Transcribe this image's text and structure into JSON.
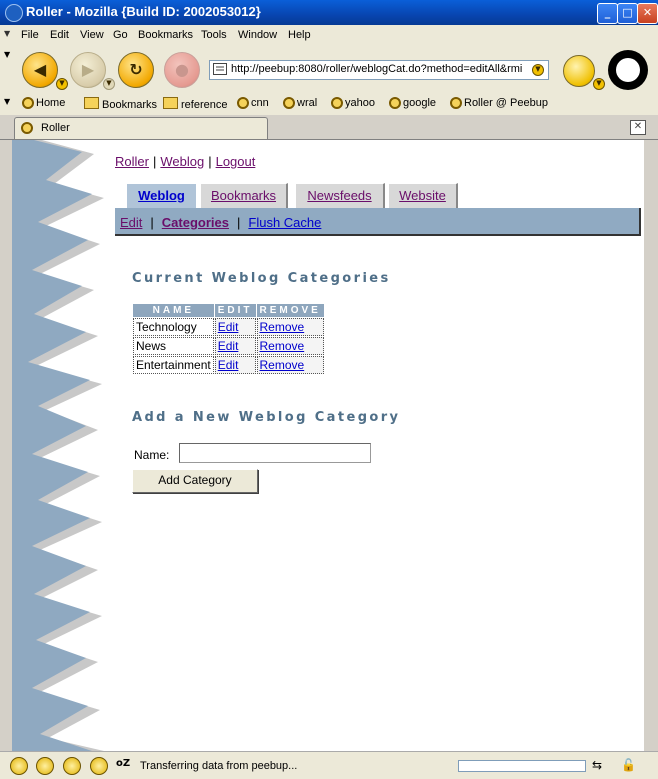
{
  "window": {
    "title": "Roller - Mozilla {Build ID: 2002053012}",
    "minimize_glyph": "_",
    "maximize_glyph": "□",
    "close_glyph": "✕"
  },
  "menu": [
    "File",
    "Edit",
    "View",
    "Go",
    "Bookmarks",
    "Tools",
    "Window",
    "Help"
  ],
  "navbar": {
    "url": "http://peebup:8080/roller/weblogCat.do?method=editAll&rmi",
    "back_icon": "back-arrow-icon",
    "forward_icon": "forward-arrow-icon",
    "reload_icon": "reload-icon",
    "stop_icon": "stop-icon"
  },
  "personal_bar": [
    "Home",
    "Bookmarks",
    "reference",
    "cnn",
    "wral",
    "yahoo",
    "google",
    "Roller @ Peebup"
  ],
  "browser_tab": {
    "label": "Roller"
  },
  "page": {
    "toplinks": [
      "Roller",
      "Weblog",
      "Logout"
    ],
    "tabs": [
      {
        "label": "Weblog",
        "active": true
      },
      {
        "label": "Bookmarks",
        "active": false
      },
      {
        "label": "Newsfeeds",
        "active": false
      },
      {
        "label": "Website",
        "active": false
      }
    ],
    "subnav": [
      "Edit",
      "Categories",
      "Flush Cache"
    ],
    "current_title": "Current Weblog Categories",
    "table": {
      "headers": [
        "NAME",
        "EDIT",
        "REMOVE"
      ],
      "rows": [
        {
          "name": "Technology",
          "edit": "Edit",
          "remove": "Remove"
        },
        {
          "name": "News",
          "edit": "Edit",
          "remove": "Remove"
        },
        {
          "name": "Entertainment",
          "edit": "Edit",
          "remove": "Remove"
        }
      ]
    },
    "add_title": "Add a New Weblog Category",
    "name_label": "Name:",
    "name_value": "",
    "add_button": "Add Category"
  },
  "status": {
    "text": "Transferring data from peebup...",
    "progress": 0
  }
}
